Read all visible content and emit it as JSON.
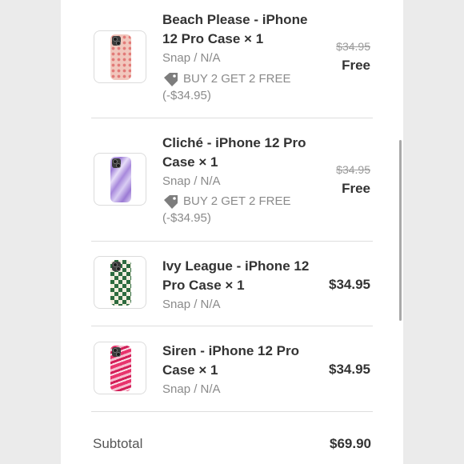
{
  "cart": {
    "items": [
      {
        "title": "Beach Please - iPhone 12 Pro Case × 1",
        "variant": "Snap / N/A",
        "discount": "BUY 2 GET 2 FREE (-$34.95)",
        "original_price": "$34.95",
        "price": "Free"
      },
      {
        "title": "Cliché - iPhone 12 Pro Case × 1",
        "variant": "Snap / N/A",
        "discount": "BUY 2 GET 2 FREE (-$34.95)",
        "original_price": "$34.95",
        "price": "Free"
      },
      {
        "title": "Ivy League - iPhone 12 Pro Case × 1",
        "variant": "Snap / N/A",
        "price": "$34.95"
      },
      {
        "title": "Siren - iPhone 12 Pro Case × 1",
        "variant": "Snap / N/A",
        "price": "$34.95"
      }
    ],
    "subtotal_label": "Subtotal",
    "subtotal_value": "$69.90"
  },
  "icons": {
    "discount": "price-tag-icon",
    "product": "phone-case-image"
  },
  "colors": {
    "background": "#ebebeb",
    "panel": "#ffffff",
    "text_primary": "#333333",
    "text_secondary": "#8a8a8a",
    "divider": "#dedede"
  }
}
